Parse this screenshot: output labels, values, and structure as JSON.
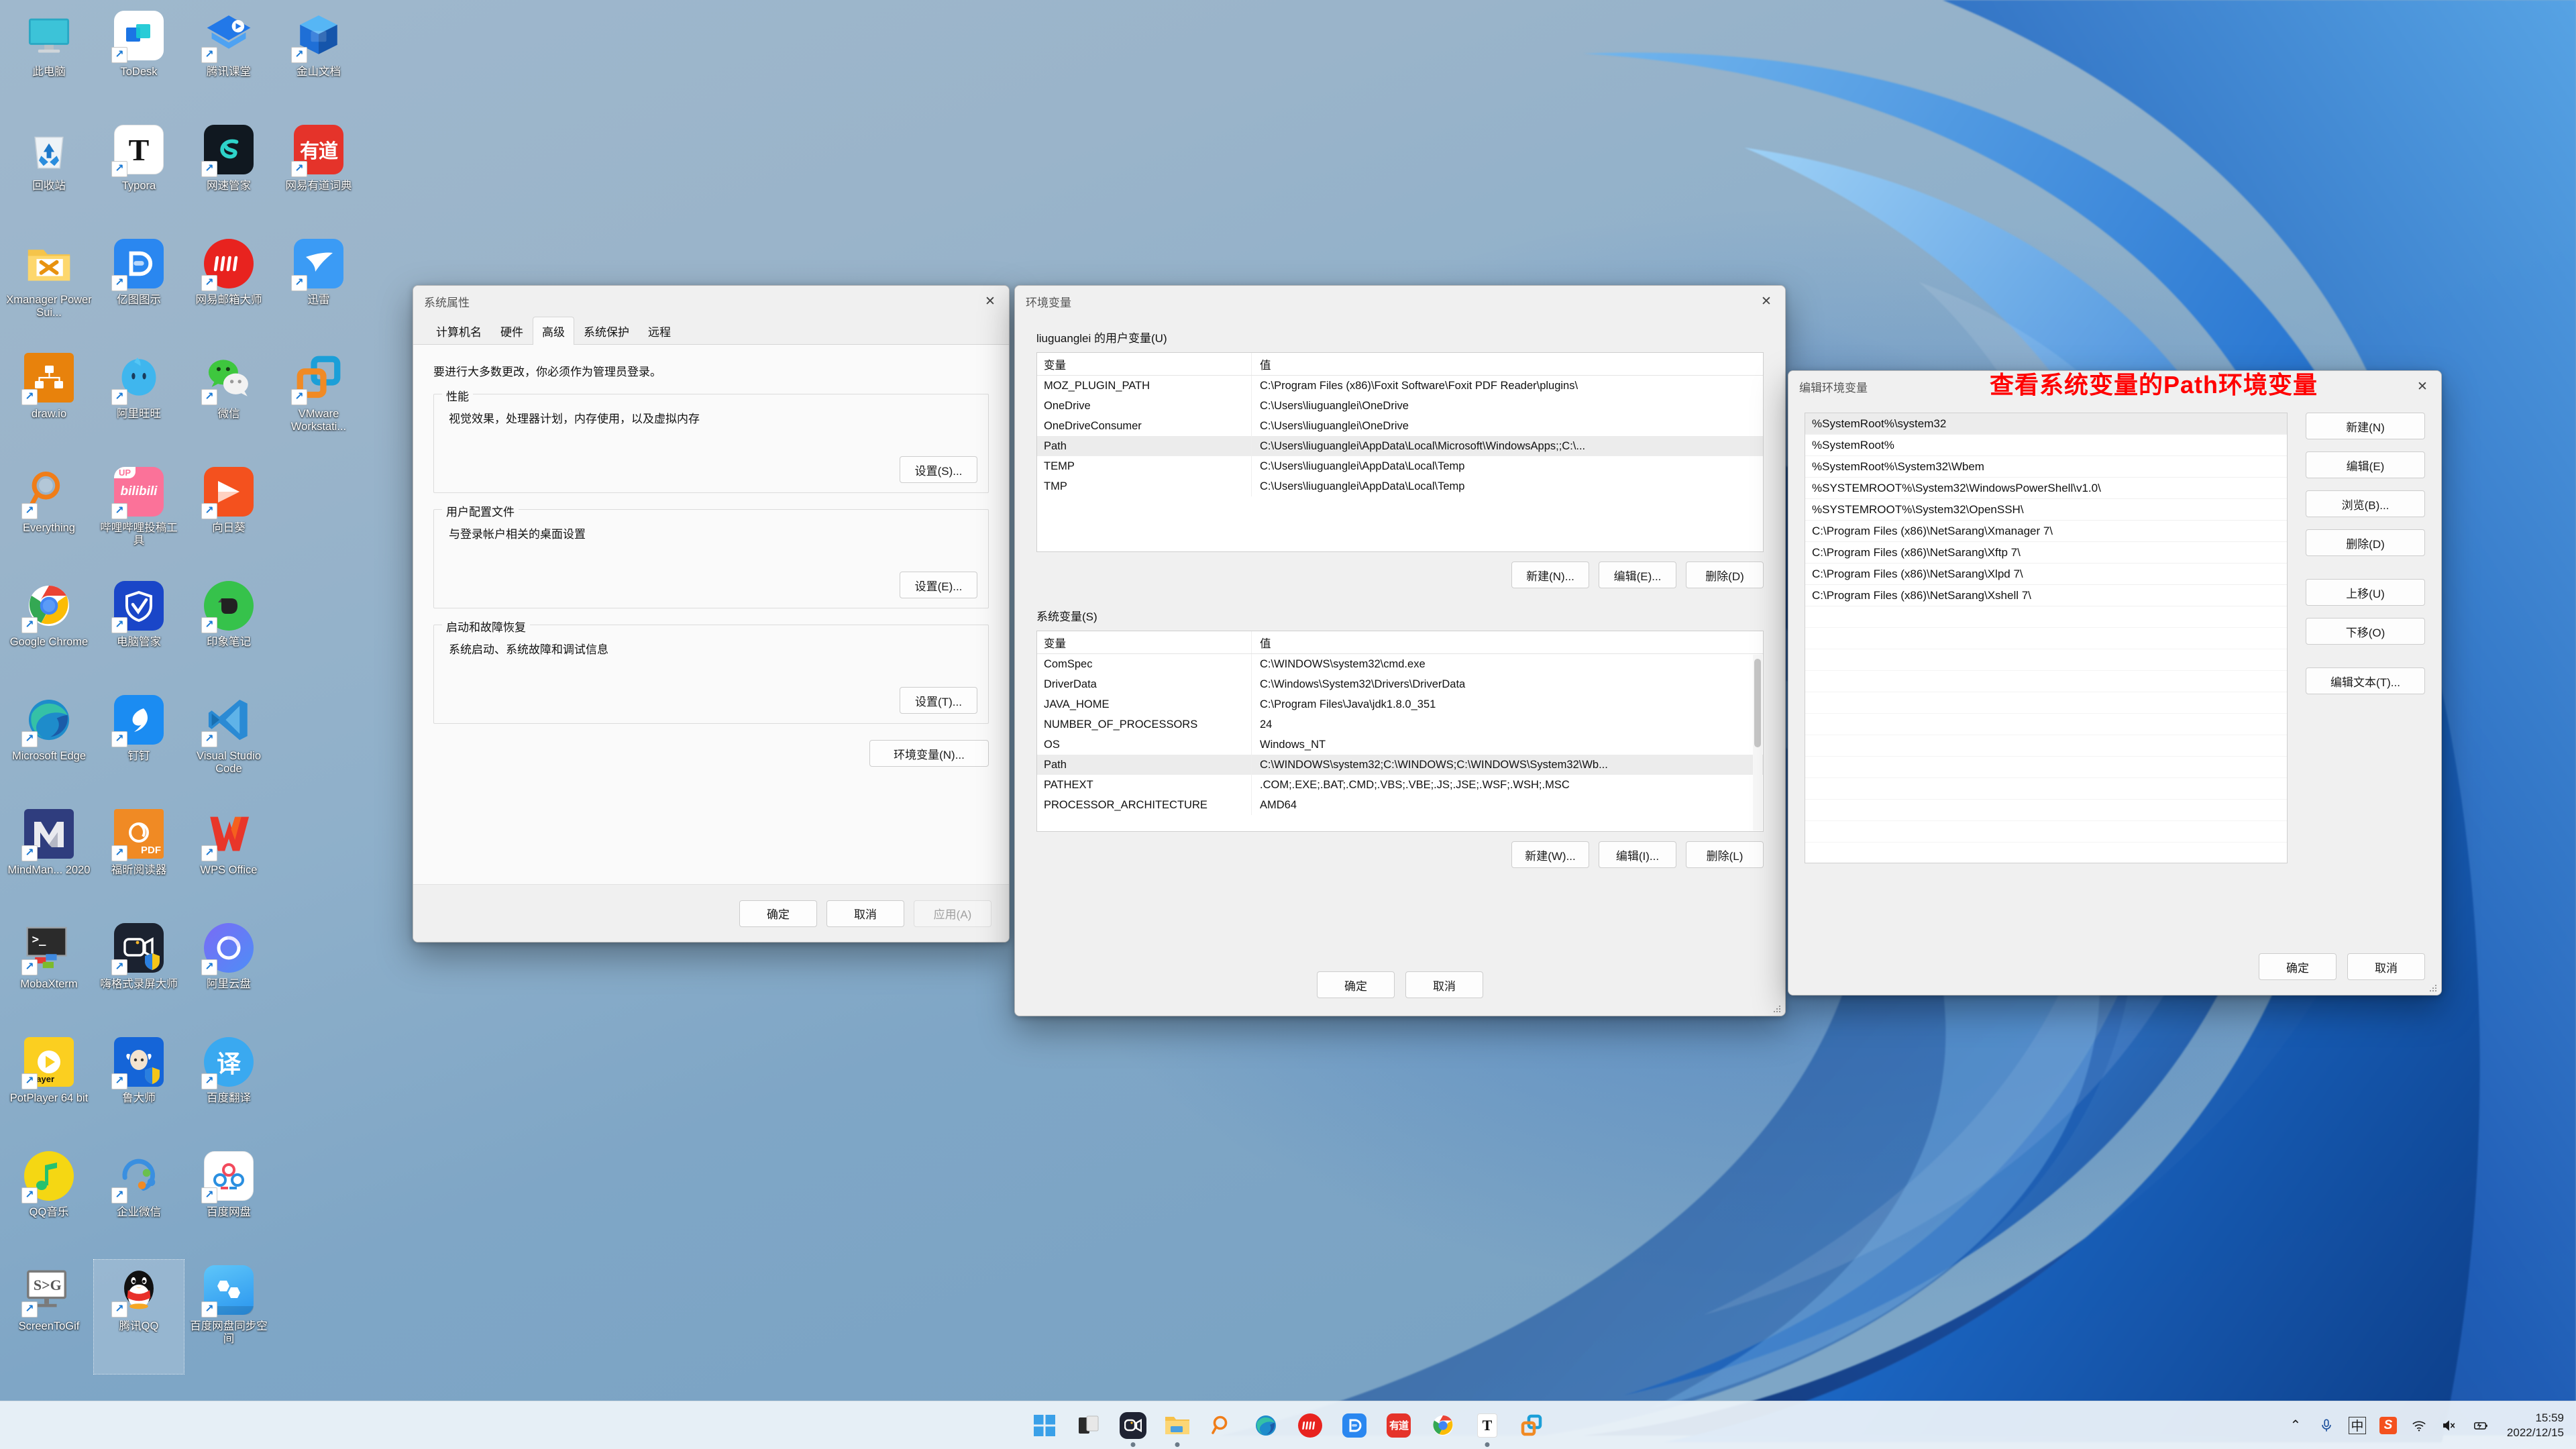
{
  "desktop": {
    "icons": [
      {
        "label": "此电脑",
        "icon": "this-pc-icon",
        "shortcut": false,
        "selected": false
      },
      {
        "label": "ToDesk",
        "icon": "todesk-icon",
        "shortcut": true,
        "selected": false
      },
      {
        "label": "腾讯课堂",
        "icon": "tencent-classroom-icon",
        "shortcut": true,
        "selected": false
      },
      {
        "label": "金山文档",
        "icon": "kingsoft-docs-icon",
        "shortcut": true,
        "selected": false
      },
      {
        "label": "回收站",
        "icon": "recycle-bin-icon",
        "shortcut": false,
        "selected": false
      },
      {
        "label": "Typora",
        "icon": "typora-icon",
        "shortcut": true,
        "selected": false
      },
      {
        "label": "网速管家",
        "icon": "netspeed-manager-icon",
        "shortcut": true,
        "selected": false
      },
      {
        "label": "网易有道词典",
        "icon": "youdao-dict-icon",
        "shortcut": true,
        "selected": false
      },
      {
        "label": "Xmanager Power Sui...",
        "icon": "xmanager-folder-icon",
        "shortcut": false,
        "selected": false
      },
      {
        "label": "亿图图示",
        "icon": "edraw-icon",
        "shortcut": true,
        "selected": false
      },
      {
        "label": "网易邮箱大师",
        "icon": "netease-mail-icon",
        "shortcut": true,
        "selected": false
      },
      {
        "label": "迅雷",
        "icon": "thunder-icon",
        "shortcut": true,
        "selected": false
      },
      {
        "label": "draw.io",
        "icon": "drawio-icon",
        "shortcut": true,
        "selected": false
      },
      {
        "label": "阿里旺旺",
        "icon": "aliwangwang-icon",
        "shortcut": true,
        "selected": false
      },
      {
        "label": "微信",
        "icon": "wechat-icon",
        "shortcut": true,
        "selected": false
      },
      {
        "label": "VMware Workstati...",
        "icon": "vmware-workstation-icon",
        "shortcut": true,
        "selected": false
      },
      {
        "label": "Everything",
        "icon": "everything-icon",
        "shortcut": true,
        "selected": false
      },
      {
        "label": "哔哩哔哩投稿工具",
        "icon": "bilibili-upload-icon",
        "shortcut": true,
        "selected": false
      },
      {
        "label": "向日葵",
        "icon": "sunlogin-icon",
        "shortcut": true,
        "selected": false
      },
      {
        "label": "",
        "icon": "blank-icon",
        "shortcut": false,
        "selected": false
      },
      {
        "label": "Google Chrome",
        "icon": "chrome-icon",
        "shortcut": true,
        "selected": false
      },
      {
        "label": "电脑管家",
        "icon": "pc-manager-icon",
        "shortcut": true,
        "selected": false
      },
      {
        "label": "印象笔记",
        "icon": "evernote-icon",
        "shortcut": true,
        "selected": false
      },
      {
        "label": "",
        "icon": "blank-icon",
        "shortcut": false,
        "selected": false
      },
      {
        "label": "Microsoft Edge",
        "icon": "edge-icon",
        "shortcut": true,
        "selected": false
      },
      {
        "label": "钉钉",
        "icon": "dingtalk-icon",
        "shortcut": true,
        "selected": false
      },
      {
        "label": "Visual Studio Code",
        "icon": "vscode-icon",
        "shortcut": true,
        "selected": false
      },
      {
        "label": "",
        "icon": "blank-icon",
        "shortcut": false,
        "selected": false
      },
      {
        "label": "MindMan... 2020",
        "icon": "mindmanager-icon",
        "shortcut": true,
        "selected": false
      },
      {
        "label": "福昕阅读器",
        "icon": "foxit-reader-icon",
        "shortcut": true,
        "selected": false
      },
      {
        "label": "WPS Office",
        "icon": "wps-office-icon",
        "shortcut": true,
        "selected": false
      },
      {
        "label": "",
        "icon": "blank-icon",
        "shortcut": false,
        "selected": false
      },
      {
        "label": "MobaXterm",
        "icon": "mobaxterm-icon",
        "shortcut": true,
        "selected": false
      },
      {
        "label": "嗨格式录屏大师",
        "icon": "higeshi-recorder-icon",
        "shortcut": true,
        "selected": false
      },
      {
        "label": "阿里云盘",
        "icon": "aliyun-drive-icon",
        "shortcut": true,
        "selected": false
      },
      {
        "label": "",
        "icon": "blank-icon",
        "shortcut": false,
        "selected": false
      },
      {
        "label": "PotPlayer 64 bit",
        "icon": "potplayer-icon",
        "shortcut": true,
        "selected": false
      },
      {
        "label": "鲁大师",
        "icon": "ludashi-icon",
        "shortcut": true,
        "selected": false
      },
      {
        "label": "百度翻译",
        "icon": "baidu-translate-icon",
        "shortcut": true,
        "selected": false
      },
      {
        "label": "",
        "icon": "blank-icon",
        "shortcut": false,
        "selected": false
      },
      {
        "label": "QQ音乐",
        "icon": "qq-music-icon",
        "shortcut": true,
        "selected": false
      },
      {
        "label": "企业微信",
        "icon": "wecom-icon",
        "shortcut": true,
        "selected": false
      },
      {
        "label": "百度网盘",
        "icon": "baidu-netdisk-icon",
        "shortcut": true,
        "selected": false
      },
      {
        "label": "",
        "icon": "blank-icon",
        "shortcut": false,
        "selected": false
      },
      {
        "label": "ScreenToGif",
        "icon": "screentogif-icon",
        "shortcut": true,
        "selected": false
      },
      {
        "label": "腾讯QQ",
        "icon": "tencent-qq-icon",
        "shortcut": true,
        "selected": true
      },
      {
        "label": "百度网盘同步空间",
        "icon": "baidu-netdisk-sync-icon",
        "shortcut": true,
        "selected": false
      },
      {
        "label": "",
        "icon": "blank-icon",
        "shortcut": false,
        "selected": false
      }
    ]
  },
  "system_properties": {
    "title": "系统属性",
    "close_label": "✕",
    "tabs": [
      {
        "label": "计算机名",
        "active": false
      },
      {
        "label": "硬件",
        "active": false
      },
      {
        "label": "高级",
        "active": true
      },
      {
        "label": "系统保护",
        "active": false
      },
      {
        "label": "远程",
        "active": false
      }
    ],
    "admin_note": "要进行大多数更改，你必须作为管理员登录。",
    "groups": [
      {
        "title": "性能",
        "desc": "视觉效果，处理器计划，内存使用，以及虚拟内存",
        "button": "设置(S)..."
      },
      {
        "title": "用户配置文件",
        "desc": "与登录帐户相关的桌面设置",
        "button": "设置(E)..."
      },
      {
        "title": "启动和故障恢复",
        "desc": "系统启动、系统故障和调试信息",
        "button": "设置(T)..."
      }
    ],
    "env_button": "环境变量(N)...",
    "footer": {
      "ok": "确定",
      "cancel": "取消",
      "apply": "应用(A)"
    }
  },
  "environment_variables": {
    "title": "环境变量",
    "close_label": "✕",
    "user_section": {
      "title": "liuguanglei 的用户变量(U)",
      "columns": [
        "变量",
        "值"
      ],
      "rows": [
        {
          "name": "MOZ_PLUGIN_PATH",
          "value": "C:\\Program Files (x86)\\Foxit Software\\Foxit PDF Reader\\plugins\\",
          "selected": false
        },
        {
          "name": "OneDrive",
          "value": "C:\\Users\\liuguanglei\\OneDrive",
          "selected": false
        },
        {
          "name": "OneDriveConsumer",
          "value": "C:\\Users\\liuguanglei\\OneDrive",
          "selected": false
        },
        {
          "name": "Path",
          "value": "C:\\Users\\liuguanglei\\AppData\\Local\\Microsoft\\WindowsApps;;C:\\...",
          "selected": true
        },
        {
          "name": "TEMP",
          "value": "C:\\Users\\liuguanglei\\AppData\\Local\\Temp",
          "selected": false
        },
        {
          "name": "TMP",
          "value": "C:\\Users\\liuguanglei\\AppData\\Local\\Temp",
          "selected": false
        }
      ],
      "buttons": {
        "new": "新建(N)...",
        "edit": "编辑(E)...",
        "delete": "删除(D)"
      }
    },
    "system_section": {
      "title": "系统变量(S)",
      "columns": [
        "变量",
        "值"
      ],
      "rows": [
        {
          "name": "ComSpec",
          "value": "C:\\WINDOWS\\system32\\cmd.exe",
          "selected": false
        },
        {
          "name": "DriverData",
          "value": "C:\\Windows\\System32\\Drivers\\DriverData",
          "selected": false
        },
        {
          "name": "JAVA_HOME",
          "value": "C:\\Program Files\\Java\\jdk1.8.0_351",
          "selected": false
        },
        {
          "name": "NUMBER_OF_PROCESSORS",
          "value": "24",
          "selected": false
        },
        {
          "name": "OS",
          "value": "Windows_NT",
          "selected": false
        },
        {
          "name": "Path",
          "value": "C:\\WINDOWS\\system32;C:\\WINDOWS;C:\\WINDOWS\\System32\\Wb...",
          "selected": true
        },
        {
          "name": "PATHEXT",
          "value": ".COM;.EXE;.BAT;.CMD;.VBS;.VBE;.JS;.JSE;.WSF;.WSH;.MSC",
          "selected": false
        },
        {
          "name": "PROCESSOR_ARCHITECTURE",
          "value": "AMD64",
          "selected": false
        }
      ],
      "buttons": {
        "new": "新建(W)...",
        "edit": "编辑(I)...",
        "delete": "删除(L)"
      }
    },
    "footer": {
      "ok": "确定",
      "cancel": "取消"
    }
  },
  "edit_environment_variable": {
    "title": "编辑环境变量",
    "close_label": "✕",
    "annotation": "查看系统变量的Path环境变量",
    "annotation_color": "#ff0000",
    "entries": [
      {
        "value": "%SystemRoot%\\system32",
        "selected": true
      },
      {
        "value": "%SystemRoot%",
        "selected": false
      },
      {
        "value": "%SystemRoot%\\System32\\Wbem",
        "selected": false
      },
      {
        "value": "%SYSTEMROOT%\\System32\\WindowsPowerShell\\v1.0\\",
        "selected": false
      },
      {
        "value": "%SYSTEMROOT%\\System32\\OpenSSH\\",
        "selected": false
      },
      {
        "value": "C:\\Program Files (x86)\\NetSarang\\Xmanager 7\\",
        "selected": false
      },
      {
        "value": "C:\\Program Files (x86)\\NetSarang\\Xftp 7\\",
        "selected": false
      },
      {
        "value": "C:\\Program Files (x86)\\NetSarang\\Xlpd 7\\",
        "selected": false
      },
      {
        "value": "C:\\Program Files (x86)\\NetSarang\\Xshell 7\\",
        "selected": false
      }
    ],
    "side_buttons": {
      "new": "新建(N)",
      "edit": "编辑(E)",
      "browse": "浏览(B)...",
      "delete": "删除(D)",
      "move_up": "上移(U)",
      "move_down": "下移(O)",
      "edit_text": "编辑文本(T)..."
    },
    "footer": {
      "ok": "确定",
      "cancel": "取消"
    }
  },
  "taskbar": {
    "items": [
      {
        "name": "start-button",
        "label": ""
      },
      {
        "name": "task-view-button",
        "label": ""
      },
      {
        "name": "chat-teams-button",
        "label": ""
      },
      {
        "name": "file-explorer-button",
        "label": ""
      },
      {
        "name": "everything-search-button",
        "label": ""
      },
      {
        "name": "edge-button",
        "label": ""
      },
      {
        "name": "netease-mail-button",
        "label": ""
      },
      {
        "name": "edraw-button",
        "label": ""
      },
      {
        "name": "youdao-dict-button",
        "label": ""
      },
      {
        "name": "chrome-button",
        "label": ""
      },
      {
        "name": "typora-button",
        "label": ""
      },
      {
        "name": "vmware-button",
        "label": ""
      }
    ],
    "tray": {
      "chevron": "⌃",
      "microphone": "🎙",
      "ime": "中",
      "sogou": "S",
      "wifi": "wifi-icon",
      "volume": "volume-muted-icon",
      "battery": "battery-charging-icon"
    },
    "clock": {
      "time": "15:59",
      "date": "2022/12/15"
    }
  }
}
